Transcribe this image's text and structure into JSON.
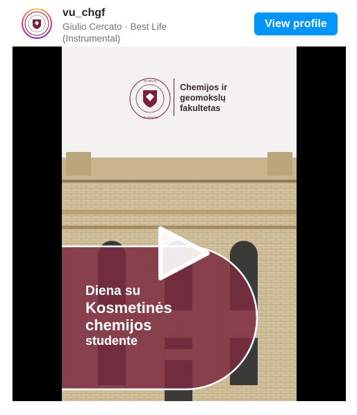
{
  "post": {
    "username": "vu_chgf",
    "audio_subline": "Giulio Cercato · Best Life (Instrumental)",
    "view_profile_label": "View profile"
  },
  "video": {
    "logo_faculty_name": "Chemijos ir\ngeomokslų\nfakultetas",
    "logo_ring_text": "VILNIAUS UNIVERSITETAS · 1579 · UNIVERSITAS VILNENSIS",
    "title_line1": "Diena su",
    "title_line2": "Kosmetinės",
    "title_line3": "chemijos",
    "title_line4": "studente"
  },
  "colors": {
    "brand_maroon": "#7b1f3f",
    "button_blue": "#0095f6",
    "overlay": "#7b2a3e"
  },
  "icons": {
    "play": "play-icon",
    "avatar": "university-logo-icon"
  }
}
